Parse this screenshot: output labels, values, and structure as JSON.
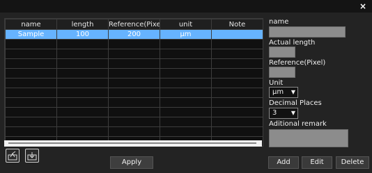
{
  "window": {
    "close_glyph": "×"
  },
  "table": {
    "headers": [
      "name",
      "length",
      "Reference(Pixel)",
      "unit",
      "Note"
    ],
    "rows": [
      [
        "Sample",
        "100",
        "200",
        "µm",
        ""
      ]
    ]
  },
  "icons": {
    "export": "export-icon",
    "import": "import-icon"
  },
  "buttons": {
    "apply": "Apply",
    "add": "Add",
    "edit": "Edit",
    "delete": "Delete"
  },
  "side": {
    "name_label": "name",
    "name_value": "",
    "actual_length_label": "Actual length",
    "actual_length_value": "",
    "reference_label": "Reference(Pixel)",
    "reference_value": "",
    "unit_label": "Unit",
    "unit_value": "µm",
    "decimal_label": "Decimal Places",
    "decimal_value": "3",
    "remark_label": "Aditional remark",
    "remark_value": ""
  },
  "colors": {
    "selected_row": "#66b3ff",
    "input_bg": "#8c8c8c"
  }
}
